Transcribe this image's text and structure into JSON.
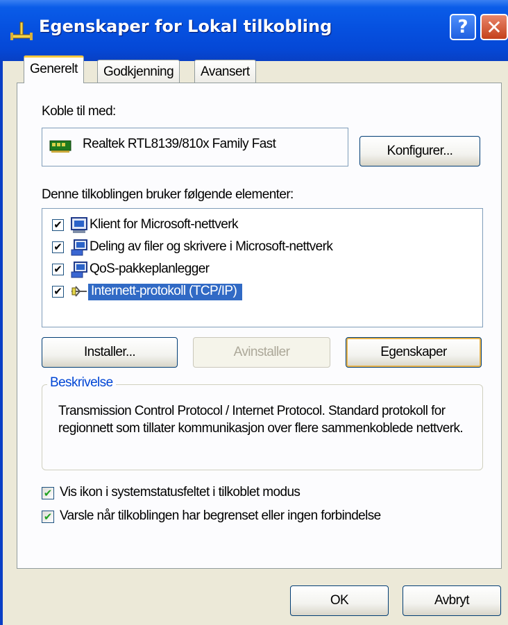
{
  "window": {
    "title": "Egenskaper for Lokal tilkobling",
    "help_label": "?",
    "close_label": "✕"
  },
  "tabs": [
    {
      "label": "Generelt",
      "active": true
    },
    {
      "label": "Godkjenning",
      "active": false
    },
    {
      "label": "Avansert",
      "active": false
    }
  ],
  "general": {
    "connect_using_label": "Koble til med:",
    "adapter_name": "Realtek RTL8139/810x Family Fast",
    "configure_button": "Konfigurer...",
    "components_label": "Denne tilkoblingen bruker følgende elementer:",
    "components": [
      {
        "label": "Klient for Microsoft-nettverk",
        "checked": true,
        "icon": "network-client-icon",
        "selected": false
      },
      {
        "label": "Deling av filer og skrivere i Microsoft-nettverk",
        "checked": true,
        "icon": "file-sharing-icon",
        "selected": false
      },
      {
        "label": "QoS-pakkeplanlegger",
        "checked": true,
        "icon": "qos-service-icon",
        "selected": false
      },
      {
        "label": "Internett-protokoll (TCP/IP)",
        "checked": true,
        "icon": "protocol-icon",
        "selected": true
      }
    ],
    "install_button": "Installer...",
    "uninstall_button": "Avinstaller",
    "properties_button": "Egenskaper",
    "description_title": "Beskrivelse",
    "description_text": "Transmission Control Protocol / Internet Protocol. Standard protokoll for regionnett som tillater kommunikasjon over flere sammenkoblede nettverk.",
    "show_icon_option": {
      "label": "Vis ikon i systemstatusfeltet i tilkoblet modus",
      "checked": true
    },
    "notify_option": {
      "label": "Varsle når tilkoblingen har begrenset eller ingen forbindelse",
      "checked": true
    }
  },
  "footer": {
    "ok_button": "OK",
    "cancel_button": "Avbryt"
  },
  "colors": {
    "titlebar": "#0651e0",
    "dialog_bg": "#ece9d8",
    "selection": "#316ac5",
    "group_title": "#0046d5",
    "checkmark": "#21a121"
  }
}
